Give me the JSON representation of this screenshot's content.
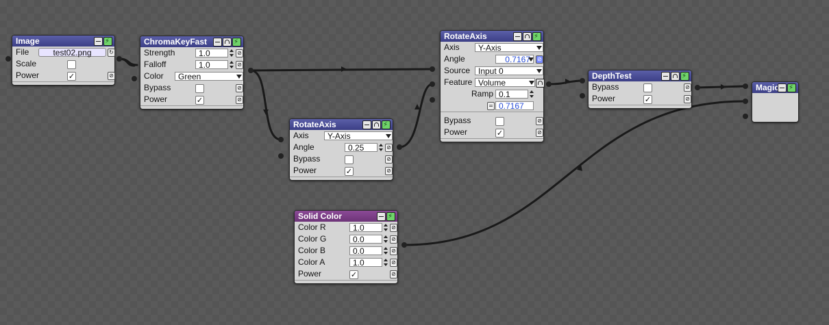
{
  "nodes": {
    "image": {
      "title": "Image",
      "file_label": "File",
      "file_value": "test02.png",
      "scale_label": "Scale",
      "power_label": "Power",
      "power_check": "✓"
    },
    "chroma": {
      "title": "ChromaKeyFast",
      "strength_label": "Strength",
      "strength_value": "1.0",
      "falloff_label": "Falloff",
      "falloff_value": "1.0",
      "color_label": "Color",
      "color_value": "Green",
      "bypass_label": "Bypass",
      "power_label": "Power",
      "power_check": "✓"
    },
    "rotate1": {
      "title": "RotateAxis",
      "axis_label": "Axis",
      "axis_value": "Y-Axis",
      "angle_label": "Angle",
      "angle_value": "0.25",
      "bypass_label": "Bypass",
      "power_label": "Power",
      "power_check": "✓"
    },
    "rotate2": {
      "title": "RotateAxis",
      "axis_label": "Axis",
      "axis_value": "Y-Axis",
      "angle_label": "Angle",
      "angle_value": "0.7167",
      "source_label": "Source",
      "source_value": "Input 0",
      "feature_label": "Feature",
      "feature_value": "Volume",
      "ramp_label": "Ramp",
      "ramp_value": "0.1",
      "ramp_out_value": "0.7167",
      "bypass_label": "Bypass",
      "power_label": "Power",
      "power_check": "✓"
    },
    "depth": {
      "title": "DepthTest",
      "bypass_label": "Bypass",
      "power_label": "Power",
      "power_check": "✓"
    },
    "magic": {
      "title": "Magic"
    },
    "solid": {
      "title": "Solid Color",
      "r_label": "Color R",
      "r_value": "1.0",
      "g_label": "Color G",
      "g_value": "0.0",
      "b_label": "Color B",
      "b_value": "0.0",
      "a_label": "Color A",
      "a_value": "1.0",
      "power_label": "Power",
      "power_check": "✓"
    }
  },
  "icons": {
    "link": "⊘",
    "refresh": "↻",
    "equals": "="
  },
  "colors": {
    "header": "#3c3f86",
    "header_alt": "#6d3478",
    "wire": "#1a1a1a",
    "power_btn": "#6fd36a"
  }
}
